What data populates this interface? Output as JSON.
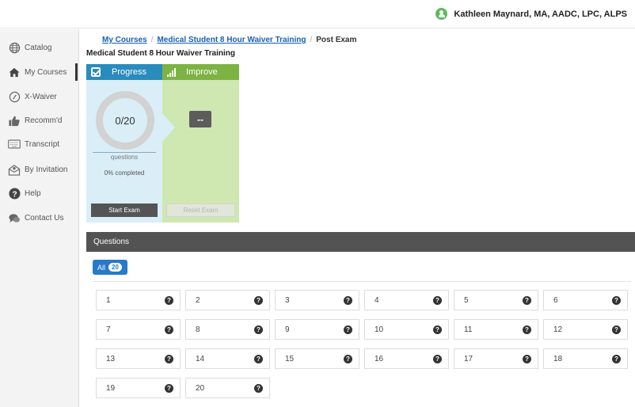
{
  "header": {
    "user_name": "Kathleen Maynard, MA, AADC, LPC, ALPS"
  },
  "sidebar": {
    "items": [
      {
        "label": "Catalog",
        "icon": "globe-icon"
      },
      {
        "label": "My Courses",
        "icon": "home-icon"
      },
      {
        "label": "X-Waiver",
        "icon": "clock-icon"
      },
      {
        "label": "Recomm'd",
        "icon": "thumbs-up-icon"
      },
      {
        "label": "Transcript",
        "icon": "keyboard-icon"
      },
      {
        "label": "By Invitation",
        "icon": "envelope-icon"
      },
      {
        "label": "Help",
        "icon": "question-icon"
      },
      {
        "label": "Contact Us",
        "icon": "chat-icon"
      }
    ]
  },
  "breadcrumb": {
    "my_courses": "My Courses",
    "course": "Medical Student 8 Hour Waiver Training",
    "current": "Post Exam"
  },
  "page_title": "Medical Student 8 Hour Waiver Training",
  "progress": {
    "title": "Progress",
    "score": "0/20",
    "questions_label": "questions",
    "percent_label": "0% completed",
    "start_button": "Start Exam"
  },
  "improve": {
    "title": "Improve",
    "value": "--",
    "reset_button": "Reset Exam"
  },
  "questions": {
    "heading": "Questions",
    "filter_label": "All",
    "filter_count": "20",
    "numbers": [
      "1",
      "2",
      "3",
      "4",
      "5",
      "6",
      "7",
      "8",
      "9",
      "10",
      "11",
      "12",
      "13",
      "14",
      "15",
      "16",
      "17",
      "18",
      "19",
      "20"
    ]
  },
  "colors": {
    "progress_accent": "#2a8bbd",
    "improve_accent": "#7cb342",
    "filter_button": "#2979c9"
  }
}
